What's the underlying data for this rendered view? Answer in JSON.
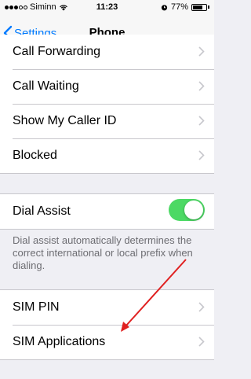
{
  "status_bar": {
    "carrier": "Siminn",
    "time": "11:23",
    "battery": "77%",
    "battery_level": 0.77,
    "signal_bars_filled": 3,
    "signal_bars_total": 5
  },
  "nav": {
    "back_label": "Settings",
    "title": "Phone"
  },
  "calls_group": {
    "items": [
      {
        "label": "Call Forwarding"
      },
      {
        "label": "Call Waiting"
      },
      {
        "label": "Show My Caller ID"
      },
      {
        "label": "Blocked"
      }
    ]
  },
  "dial_assist": {
    "label": "Dial Assist",
    "enabled": true,
    "description": "Dial assist automatically determines the correct international or local prefix when dialing."
  },
  "sim_group": {
    "items": [
      {
        "label": "SIM PIN"
      },
      {
        "label": "SIM Applications"
      }
    ]
  },
  "colors": {
    "accent": "#007aff",
    "toggle_on": "#4cd964",
    "annotation_arrow": "#e02020",
    "background": "#efeff4"
  },
  "icons": [
    "wifi-icon",
    "alarm-icon",
    "battery-icon",
    "back-chevron-icon",
    "chevron-right-icon"
  ]
}
